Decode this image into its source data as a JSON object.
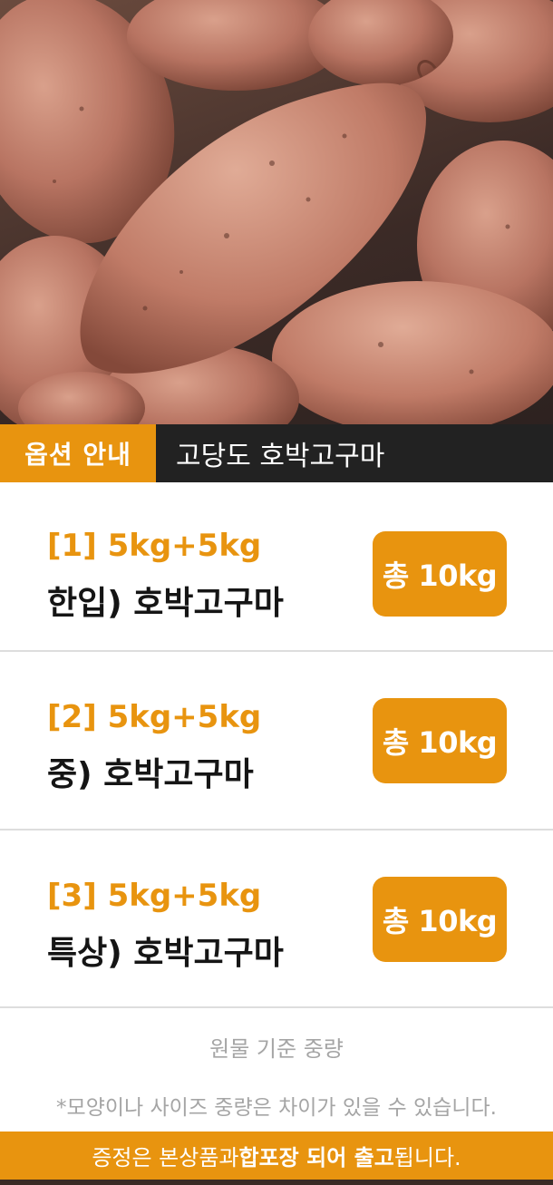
{
  "hero": {
    "image_label": "sweet-potatoes-photo"
  },
  "header": {
    "tag": "옵션 안내",
    "title": "고당도 호박고구마"
  },
  "options": [
    {
      "code": "[1] 5kg+5kg",
      "name": "한입) 호박고구마",
      "total": "총 10kg"
    },
    {
      "code": "[2] 5kg+5kg",
      "name": "중) 호박고구마",
      "total": "총 10kg"
    },
    {
      "code": "[3] 5kg+5kg",
      "name": "특상) 호박고구마",
      "total": "총 10kg"
    }
  ],
  "notes": {
    "weight_basis": "원물 기준 중량",
    "disclaimer": "*모양이나 사이즈 중량은 차이가 있을 수 있습니다."
  },
  "gift": {
    "part1": "증정은 본상품과 ",
    "part2": "합포장 되어 출고",
    "part3": "됩니다."
  },
  "colors": {
    "accent": "#e8940f",
    "dark": "#222222",
    "muted": "#a5a5a5"
  }
}
